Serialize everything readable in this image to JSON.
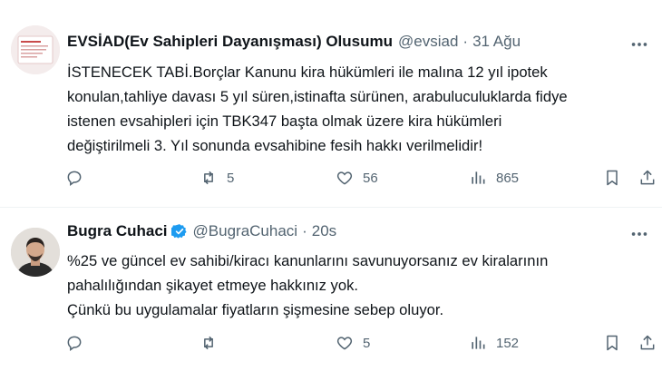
{
  "tweets": [
    {
      "name": "EVSİAD(Ev Sahipleri Dayanışması) Olusumu",
      "handle": "@evsiad",
      "dot": "·",
      "time": "31 Ağu",
      "verified": false,
      "lines": [
        "İSTENECEK TABİ.Borçlar Kanunu kira hükümleri ile malına 12 yıl ipotek",
        "konulan,tahliye davası 5 yıl süren,istinafta sürünen, arabuluculuklarda fidye",
        "istenen evsahipleri için TBK347 başta olmak üzere kira hükümleri",
        "değiştirilmeli 3. Yıl sonunda evsahibine fesih hakkı verilmelidir!"
      ],
      "replies": "",
      "retweets": "5",
      "likes": "56",
      "views": "865"
    },
    {
      "name": "Bugra Cuhaci",
      "handle": "@BugraCuhaci",
      "dot": "·",
      "time": "20s",
      "verified": true,
      "lines": [
        "%25 ve güncel ev sahibi/kiracı kanunlarını savunuyorsanız ev kiralarının",
        "pahalılığından şikayet etmeye hakkınız yok.",
        "Çünkü bu uygulamalar fiyatların şişmesine sebep oluyor."
      ],
      "replies": "",
      "retweets": "",
      "likes": "5",
      "views": "152"
    }
  ],
  "icons": {
    "more": "more-horizontal-icon",
    "reply": "reply-icon",
    "retweet": "retweet-icon",
    "like": "heart-icon",
    "views": "views-chart-icon",
    "bookmark": "bookmark-icon",
    "share": "share-icon",
    "verified": "verified-badge-icon"
  },
  "colors": {
    "text": "#0f1419",
    "secondary": "#536471",
    "verified": "#1d9bf0",
    "divider": "#eff3f4"
  }
}
